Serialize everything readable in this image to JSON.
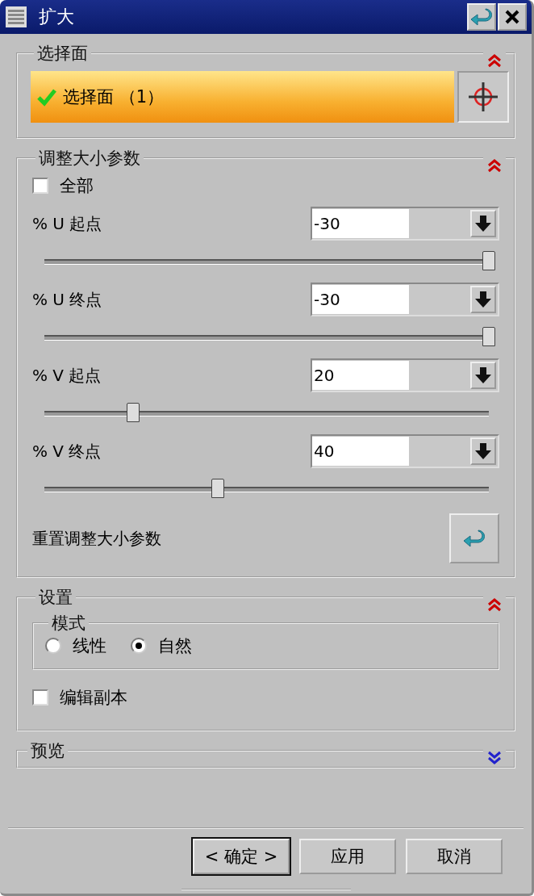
{
  "window": {
    "title": "扩大"
  },
  "sections": [
    {
      "kind": "select",
      "title": "选择面",
      "expanded": true,
      "selection": {
        "label": "选择面 （1）",
        "done": true
      }
    },
    {
      "kind": "params",
      "title": "调整大小参数",
      "expanded": true,
      "all": {
        "label": "全部",
        "checked": false
      },
      "params": [
        {
          "label": "% U 起点",
          "value": "-30",
          "level": 1
        },
        {
          "label": "% U 终点",
          "value": "-30",
          "level": 1
        },
        {
          "label": "% V 起点",
          "value": "20",
          "level": 0.2
        },
        {
          "label": "% V 终点",
          "value": "40",
          "level": 0.39
        }
      ],
      "reset_label": "重置调整大小参数"
    },
    {
      "kind": "settings",
      "title": "设置",
      "expanded": true,
      "mode": {
        "title": "模式",
        "options": [
          {
            "label": "线性",
            "selected": false
          },
          {
            "label": "自然",
            "selected": true
          }
        ]
      },
      "edit_copy": {
        "label": "编辑副本",
        "checked": false
      }
    },
    {
      "kind": "preview",
      "title": "预览",
      "expanded": false
    }
  ],
  "buttons": [
    {
      "label": "< 确定 >",
      "default": true
    },
    {
      "label": "应用",
      "default": false
    },
    {
      "label": "取消",
      "default": false
    }
  ]
}
